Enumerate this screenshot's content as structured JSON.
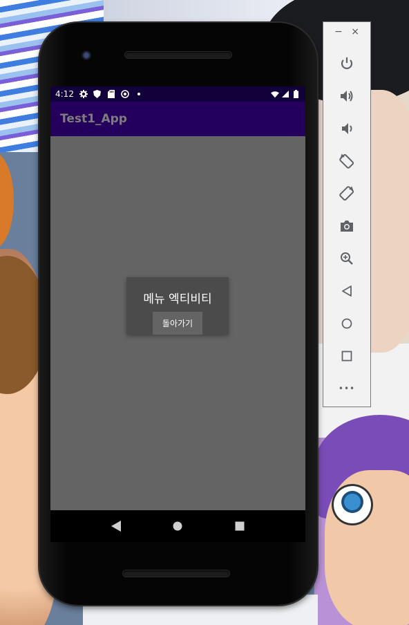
{
  "statusbar": {
    "time": "4:12",
    "left_icons": [
      "settings-icon",
      "shield-icon",
      "sd-card-icon",
      "sync-icon",
      "dot-icon"
    ],
    "right_icons": [
      "wifi-icon",
      "signal-icon",
      "battery-icon"
    ]
  },
  "app": {
    "title": "Test1_App",
    "colors": {
      "statusbar": "#12003a",
      "appbar": "#24005c",
      "background": "#646464"
    }
  },
  "dialog": {
    "message": "메뉴 엑티비티",
    "back_button": "돌아가기"
  },
  "navbar": {
    "buttons": [
      "back-icon",
      "home-icon",
      "recents-icon"
    ]
  },
  "emulator_toolbar": {
    "window_controls": {
      "minimize": "−",
      "close": "×"
    },
    "tools": [
      "power-icon",
      "volume-up-icon",
      "volume-down-icon",
      "rotate-left-icon",
      "rotate-right-icon",
      "camera-icon",
      "zoom-icon",
      "back-icon",
      "home-icon",
      "overview-icon",
      "more-icon"
    ],
    "more_label": "•••"
  }
}
